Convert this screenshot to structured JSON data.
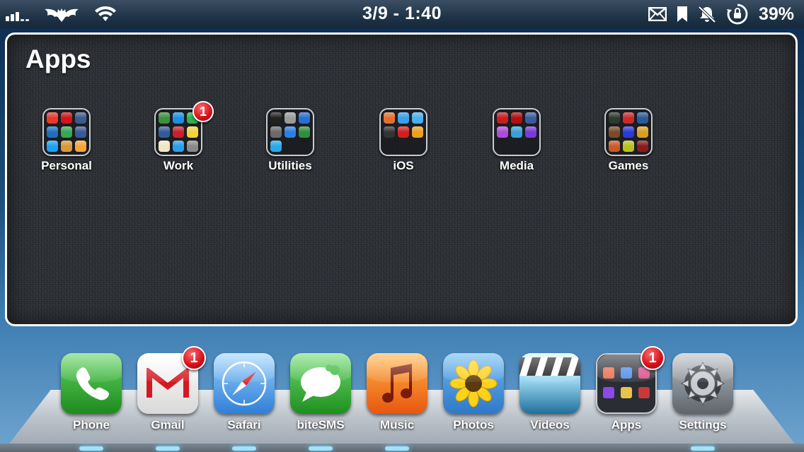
{
  "status_bar": {
    "clock": "3/9 - 1:40",
    "battery_percent": "39%",
    "signal_bars": 3,
    "icons": [
      "signal-icon",
      "batman-carrier-icon",
      "wifi-icon",
      "mail-icon",
      "bookmark-icon",
      "bell-muted-icon",
      "rotation-lock-icon"
    ]
  },
  "panel": {
    "title": "Apps",
    "folders": [
      {
        "label": "Personal",
        "badge": null,
        "minis": [
          "#e8392b",
          "#d0151b",
          "#3a5b8c",
          "#1f6fc0",
          "#34a853",
          "#3b5998",
          "#1da1f2",
          "#d79a3a",
          "#f6a43b"
        ]
      },
      {
        "label": "Work",
        "badge": "1",
        "minis": [
          "#3f8f3f",
          "#1d8fe3",
          "#2bb24c",
          "#345a9a",
          "#c8202a",
          "#f4d23a",
          "#f0e6c8",
          "#2a9ee6",
          "#8a8a8a"
        ]
      },
      {
        "label": "Utilities",
        "badge": null,
        "minis": [
          "#222222",
          "#9a9a9a",
          "#2a6fd0",
          "#6a6a6a",
          "#2b7fe0",
          "#2f8f3f",
          "#2aa8e8"
        ]
      },
      {
        "label": "iOS",
        "badge": null,
        "minis": [
          "#e07030",
          "#3aa0e8",
          "#4ab0f0",
          "#333333",
          "#d02020",
          "#e8a020"
        ]
      },
      {
        "label": "Media",
        "badge": null,
        "minis": [
          "#c81e1e",
          "#b01010",
          "#3a5b9c",
          "#b04ad8",
          "#3aa0d8",
          "#7a3ad8"
        ]
      },
      {
        "label": "Games",
        "badge": null,
        "minis": [
          "#2e3a2e",
          "#c82a2a",
          "#2a5a9a",
          "#7a4a2a",
          "#2a3ad8",
          "#d8a020",
          "#c85a2a",
          "#b8c020",
          "#8a1a1a"
        ]
      }
    ]
  },
  "dock": {
    "apps": [
      {
        "label": "Phone",
        "badge": null,
        "color": "#2fa82f",
        "icon": "phone-icon"
      },
      {
        "label": "Gmail",
        "badge": "1",
        "color": "#f2f2f2",
        "icon": "gmail-icon"
      },
      {
        "label": "Safari",
        "badge": null,
        "color": "#3b8fe0",
        "icon": "compass-icon"
      },
      {
        "label": "biteSMS",
        "badge": null,
        "color": "#2fa82f",
        "icon": "chat-bubble-icon"
      },
      {
        "label": "Music",
        "badge": null,
        "color": "#f07a10",
        "icon": "music-note-icon"
      },
      {
        "label": "Photos",
        "badge": null,
        "color": "#4aa0e0",
        "icon": "sunflower-icon"
      },
      {
        "label": "Videos",
        "badge": null,
        "color": "#1a3a5a",
        "icon": "clapperboard-icon"
      },
      {
        "label": "Apps",
        "badge": "1",
        "color": "#2a2d33",
        "icon": "folder-icon"
      },
      {
        "label": "Settings",
        "badge": null,
        "color": "#8a8f96",
        "icon": "gear-icon"
      }
    ]
  },
  "colors": {
    "badge_red": "#d0101a",
    "panel_bg": "#2c2f34",
    "dock_indicator": "#9fe3ff"
  }
}
